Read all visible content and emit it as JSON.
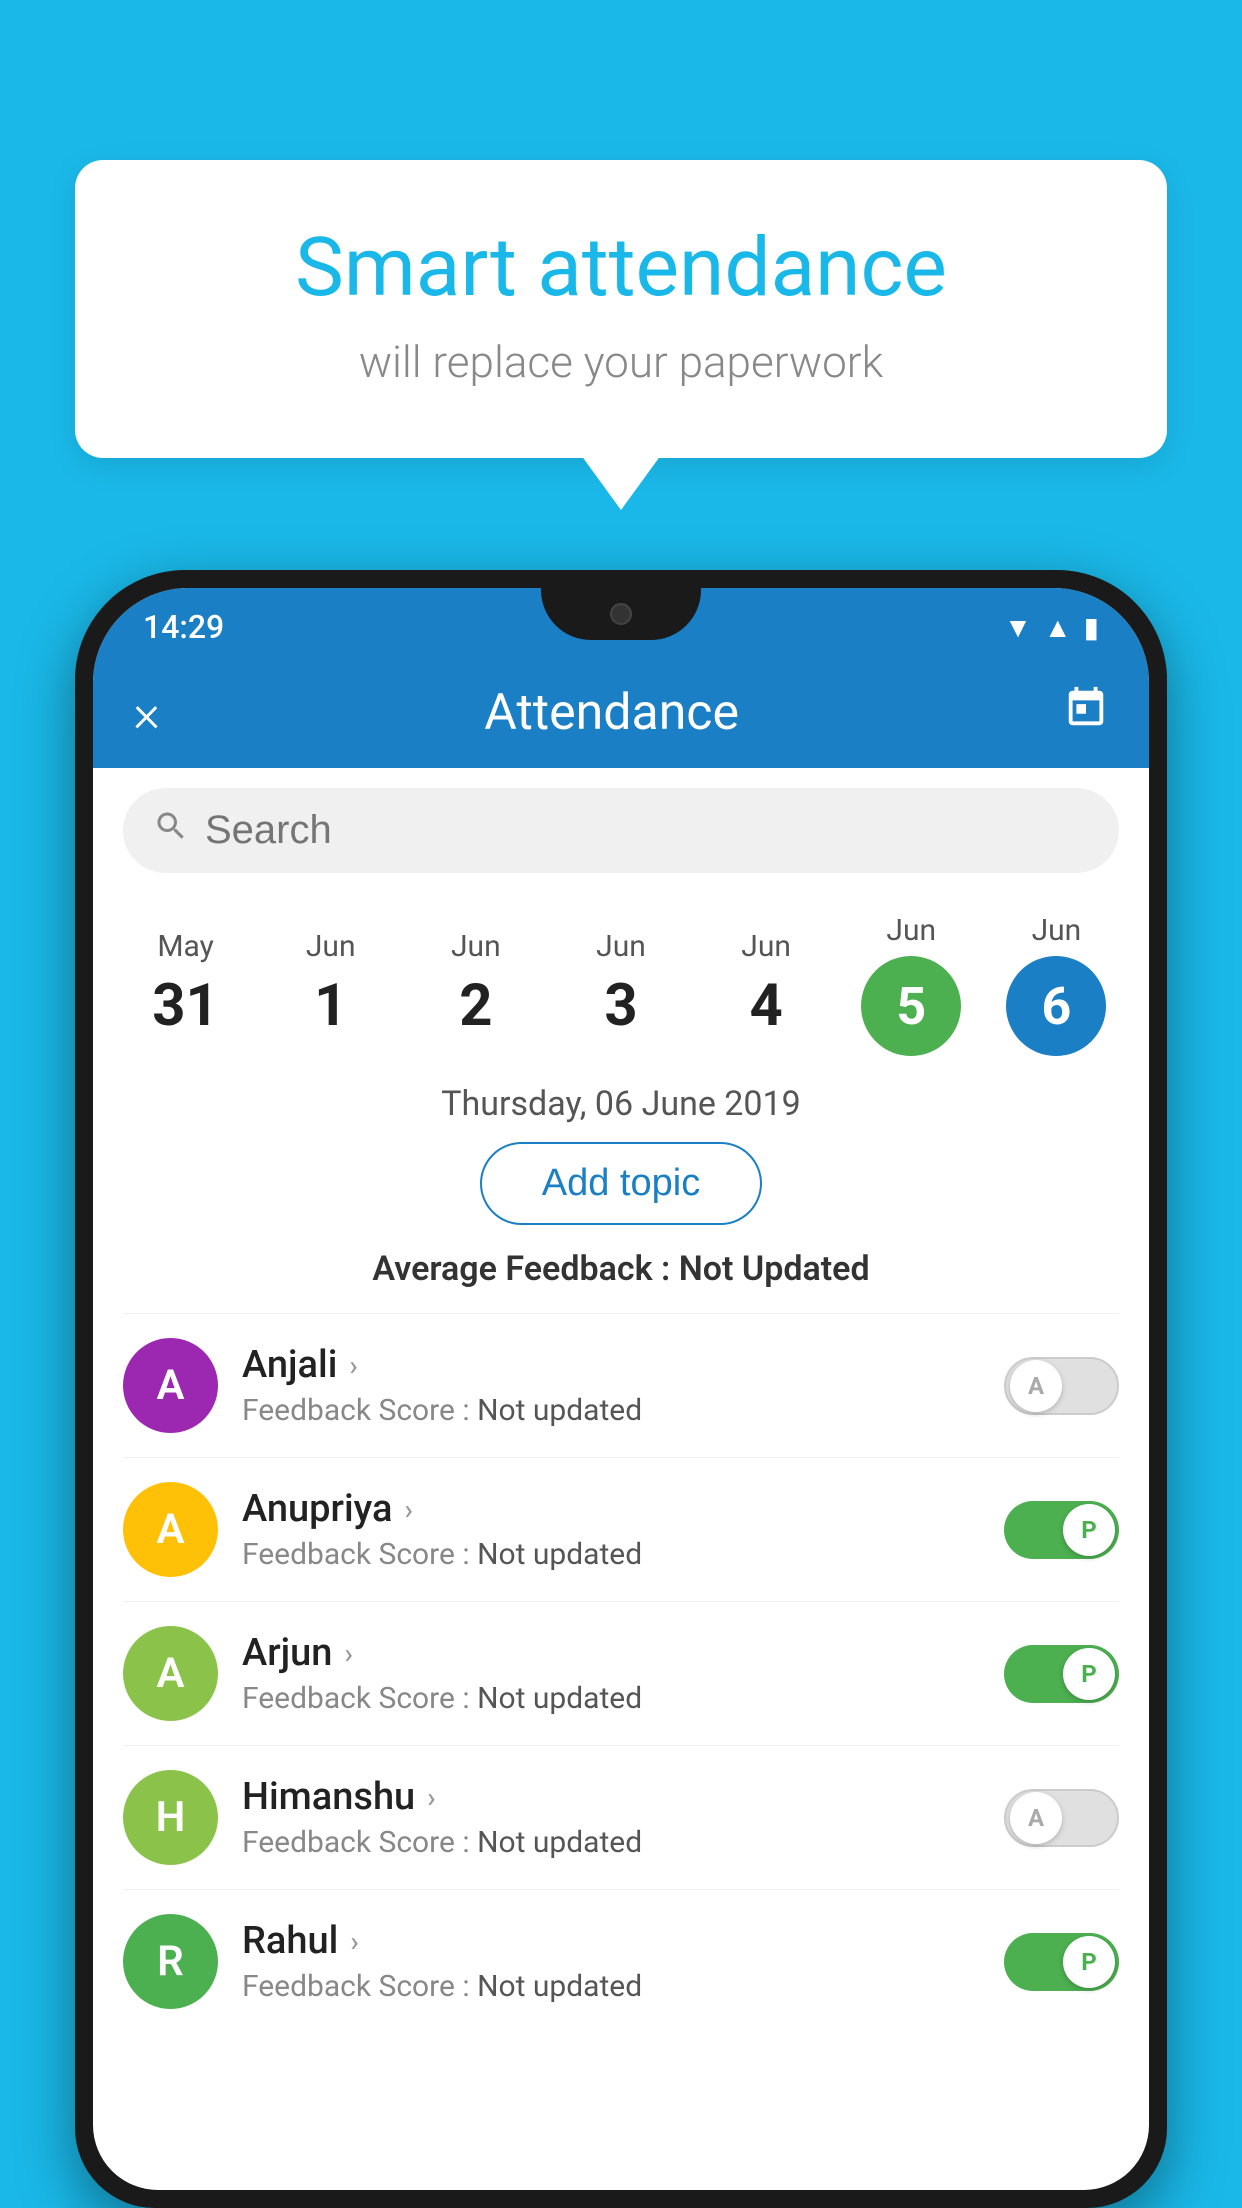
{
  "background_color": "#1ab8e8",
  "bubble": {
    "title": "Smart attendance",
    "subtitle": "will replace your paperwork"
  },
  "phone": {
    "status_bar": {
      "time": "14:29",
      "icons": [
        "wifi",
        "signal",
        "battery"
      ]
    },
    "app_bar": {
      "close_label": "×",
      "title": "Attendance",
      "calendar_icon": "📅"
    },
    "search": {
      "placeholder": "Search"
    },
    "dates": [
      {
        "month": "May",
        "day": "31",
        "state": "normal"
      },
      {
        "month": "Jun",
        "day": "1",
        "state": "normal"
      },
      {
        "month": "Jun",
        "day": "2",
        "state": "normal"
      },
      {
        "month": "Jun",
        "day": "3",
        "state": "normal"
      },
      {
        "month": "Jun",
        "day": "4",
        "state": "normal"
      },
      {
        "month": "Jun",
        "day": "5",
        "state": "today"
      },
      {
        "month": "Jun",
        "day": "6",
        "state": "selected"
      }
    ],
    "selected_date_label": "Thursday, 06 June 2019",
    "add_topic_label": "Add topic",
    "average_feedback": {
      "label": "Average Feedback : ",
      "value": "Not Updated"
    },
    "students": [
      {
        "name": "Anjali",
        "initial": "A",
        "avatar_color": "#9c27b0",
        "feedback_label": "Feedback Score : ",
        "feedback_value": "Not updated",
        "toggle_state": "off",
        "toggle_label": "A"
      },
      {
        "name": "Anupriya",
        "initial": "A",
        "avatar_color": "#ffc107",
        "feedback_label": "Feedback Score : ",
        "feedback_value": "Not updated",
        "toggle_state": "on",
        "toggle_label": "P"
      },
      {
        "name": "Arjun",
        "initial": "A",
        "avatar_color": "#8bc34a",
        "feedback_label": "Feedback Score : ",
        "feedback_value": "Not updated",
        "toggle_state": "on",
        "toggle_label": "P"
      },
      {
        "name": "Himanshu",
        "initial": "H",
        "avatar_color": "#8bc34a",
        "feedback_label": "Feedback Score : ",
        "feedback_value": "Not updated",
        "toggle_state": "off",
        "toggle_label": "A"
      },
      {
        "name": "Rahul",
        "initial": "R",
        "avatar_color": "#4caf50",
        "feedback_label": "Feedback Score : ",
        "feedback_value": "Not updated",
        "toggle_state": "on",
        "toggle_label": "P"
      }
    ]
  }
}
